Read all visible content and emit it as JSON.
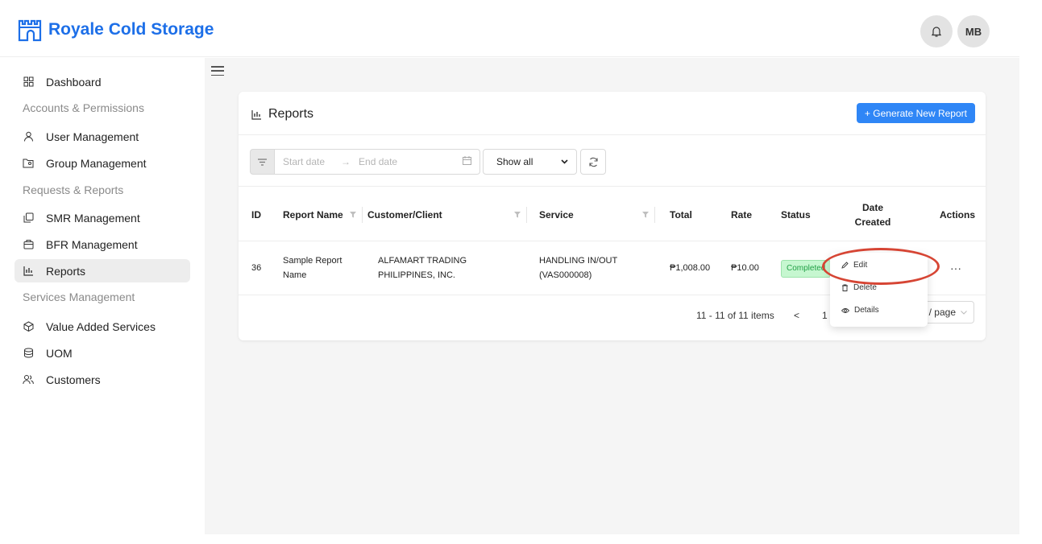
{
  "app": {
    "brand": "Royale Cold Storage"
  },
  "header": {
    "bell_icon": "bell-icon",
    "avatar": "MB"
  },
  "sidebar": {
    "items": [
      {
        "label": "Dashboard",
        "icon": "dashboard-grid-icon"
      },
      {
        "section": "Accounts & Permissions"
      },
      {
        "label": "User Management",
        "icon": "user-icon"
      },
      {
        "label": "Group Management",
        "icon": "group-folder-icon"
      },
      {
        "section": "Requests & Reports"
      },
      {
        "label": "SMR Management",
        "icon": "copy-icon"
      },
      {
        "label": "BFR Management",
        "icon": "briefcase-icon"
      },
      {
        "label": "Reports",
        "icon": "chart-icon",
        "active": true
      },
      {
        "section": "Services Management"
      },
      {
        "label": "Value Added Services",
        "icon": "cube-icon"
      },
      {
        "label": "UOM",
        "icon": "database-icon"
      },
      {
        "label": "Customers",
        "icon": "users-icon"
      }
    ]
  },
  "page": {
    "title": "Reports",
    "generate_button": "+ Generate New Report"
  },
  "filters": {
    "start_placeholder": "Start date",
    "end_placeholder": "End date",
    "show_select": "Show all"
  },
  "table": {
    "columns": [
      "ID",
      "Report Name",
      "Customer/Client",
      "Service",
      "Total",
      "Rate",
      "Status",
      "Date Created",
      "Actions"
    ],
    "rows": [
      {
        "id": "36",
        "report_name_1": "Sample Report",
        "report_name_2": "Name",
        "customer_1": "ALFAMART TRADING",
        "customer_2": "PHILIPPINES, INC.",
        "service_1": "HANDLING IN/OUT",
        "service_2": "(VAS000008)",
        "total": "₱1,008.00",
        "rate": "₱10.00",
        "status": "Completed",
        "actions": "···"
      }
    ]
  },
  "pagination": {
    "summary": "11 - 11 of 11 items",
    "prev": "<",
    "page": "1",
    "page_size": "/ page"
  },
  "action_menu": {
    "edit": "Edit",
    "delete": "Delete",
    "details": "Details"
  },
  "colors": {
    "accent": "#1d6fe8",
    "button": "#2f86f6",
    "status_completed": "#c6f7d0",
    "callout": "#d64534"
  }
}
